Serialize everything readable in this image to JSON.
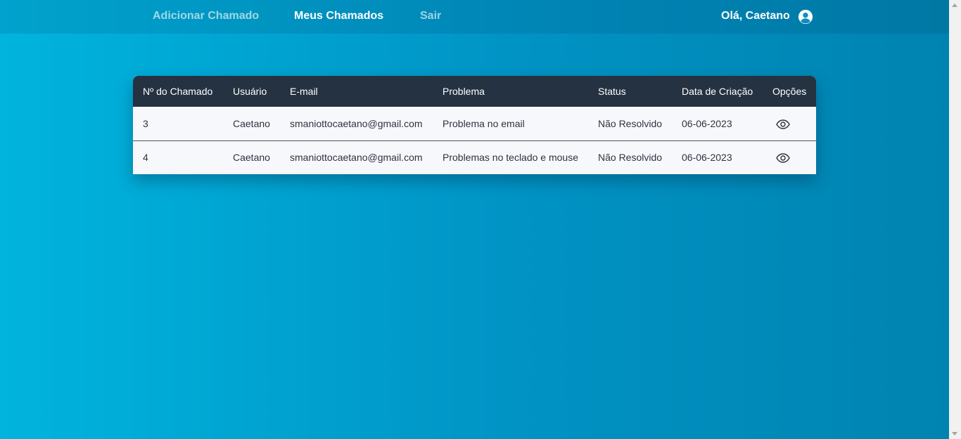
{
  "nav": {
    "links": [
      {
        "label": "Adicionar Chamado",
        "active": false
      },
      {
        "label": "Meus Chamados",
        "active": true
      },
      {
        "label": "Sair",
        "active": false
      }
    ],
    "greeting": "Olá, Caetano",
    "user_icon": "user-circle-icon"
  },
  "table": {
    "headers": [
      "Nº do Chamado",
      "Usuário",
      "E-mail",
      "Problema",
      "Status",
      "Data de Criação",
      "Opções"
    ],
    "rows": [
      {
        "id": "3",
        "user": "Caetano",
        "email": "smaniottocaetano@gmail.com",
        "problem": "Problema no email",
        "status": "Não Resolvido",
        "created": "06-06-2023",
        "action_icon": "eye-icon"
      },
      {
        "id": "4",
        "user": "Caetano",
        "email": "smaniottocaetano@gmail.com",
        "problem": "Problemas no teclado e mouse",
        "status": "Não Resolvido",
        "created": "06-06-2023",
        "action_icon": "eye-icon"
      }
    ]
  },
  "colors": {
    "background_start": "#00b4de",
    "background_end": "#0083b0",
    "table_header": "#253241",
    "row_background": "#f7f8fb"
  }
}
